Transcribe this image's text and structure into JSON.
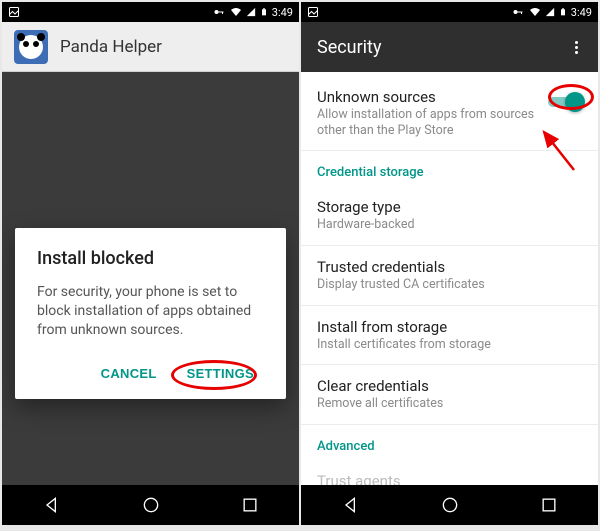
{
  "status": {
    "time": "3:49"
  },
  "left": {
    "app_title": "Panda Helper",
    "dialog": {
      "title": "Install blocked",
      "body": "For security, your phone is set to block installation of apps obtained from unknown sources.",
      "cancel": "CANCEL",
      "settings": "SETTINGS"
    }
  },
  "right": {
    "appbar_title": "Security",
    "unknown_sources": {
      "title": "Unknown sources",
      "sub": "Allow installation of apps from sources other than the Play Store",
      "enabled": true
    },
    "section_credential": "Credential storage",
    "storage_type": {
      "title": "Storage type",
      "sub": "Hardware-backed"
    },
    "trusted": {
      "title": "Trusted credentials",
      "sub": "Display trusted CA certificates"
    },
    "install_storage": {
      "title": "Install from storage",
      "sub": "Install certificates from storage"
    },
    "clear": {
      "title": "Clear credentials",
      "sub": "Remove all certificates"
    },
    "section_advanced": "Advanced",
    "trust_agents": {
      "title": "Trust agents"
    }
  }
}
